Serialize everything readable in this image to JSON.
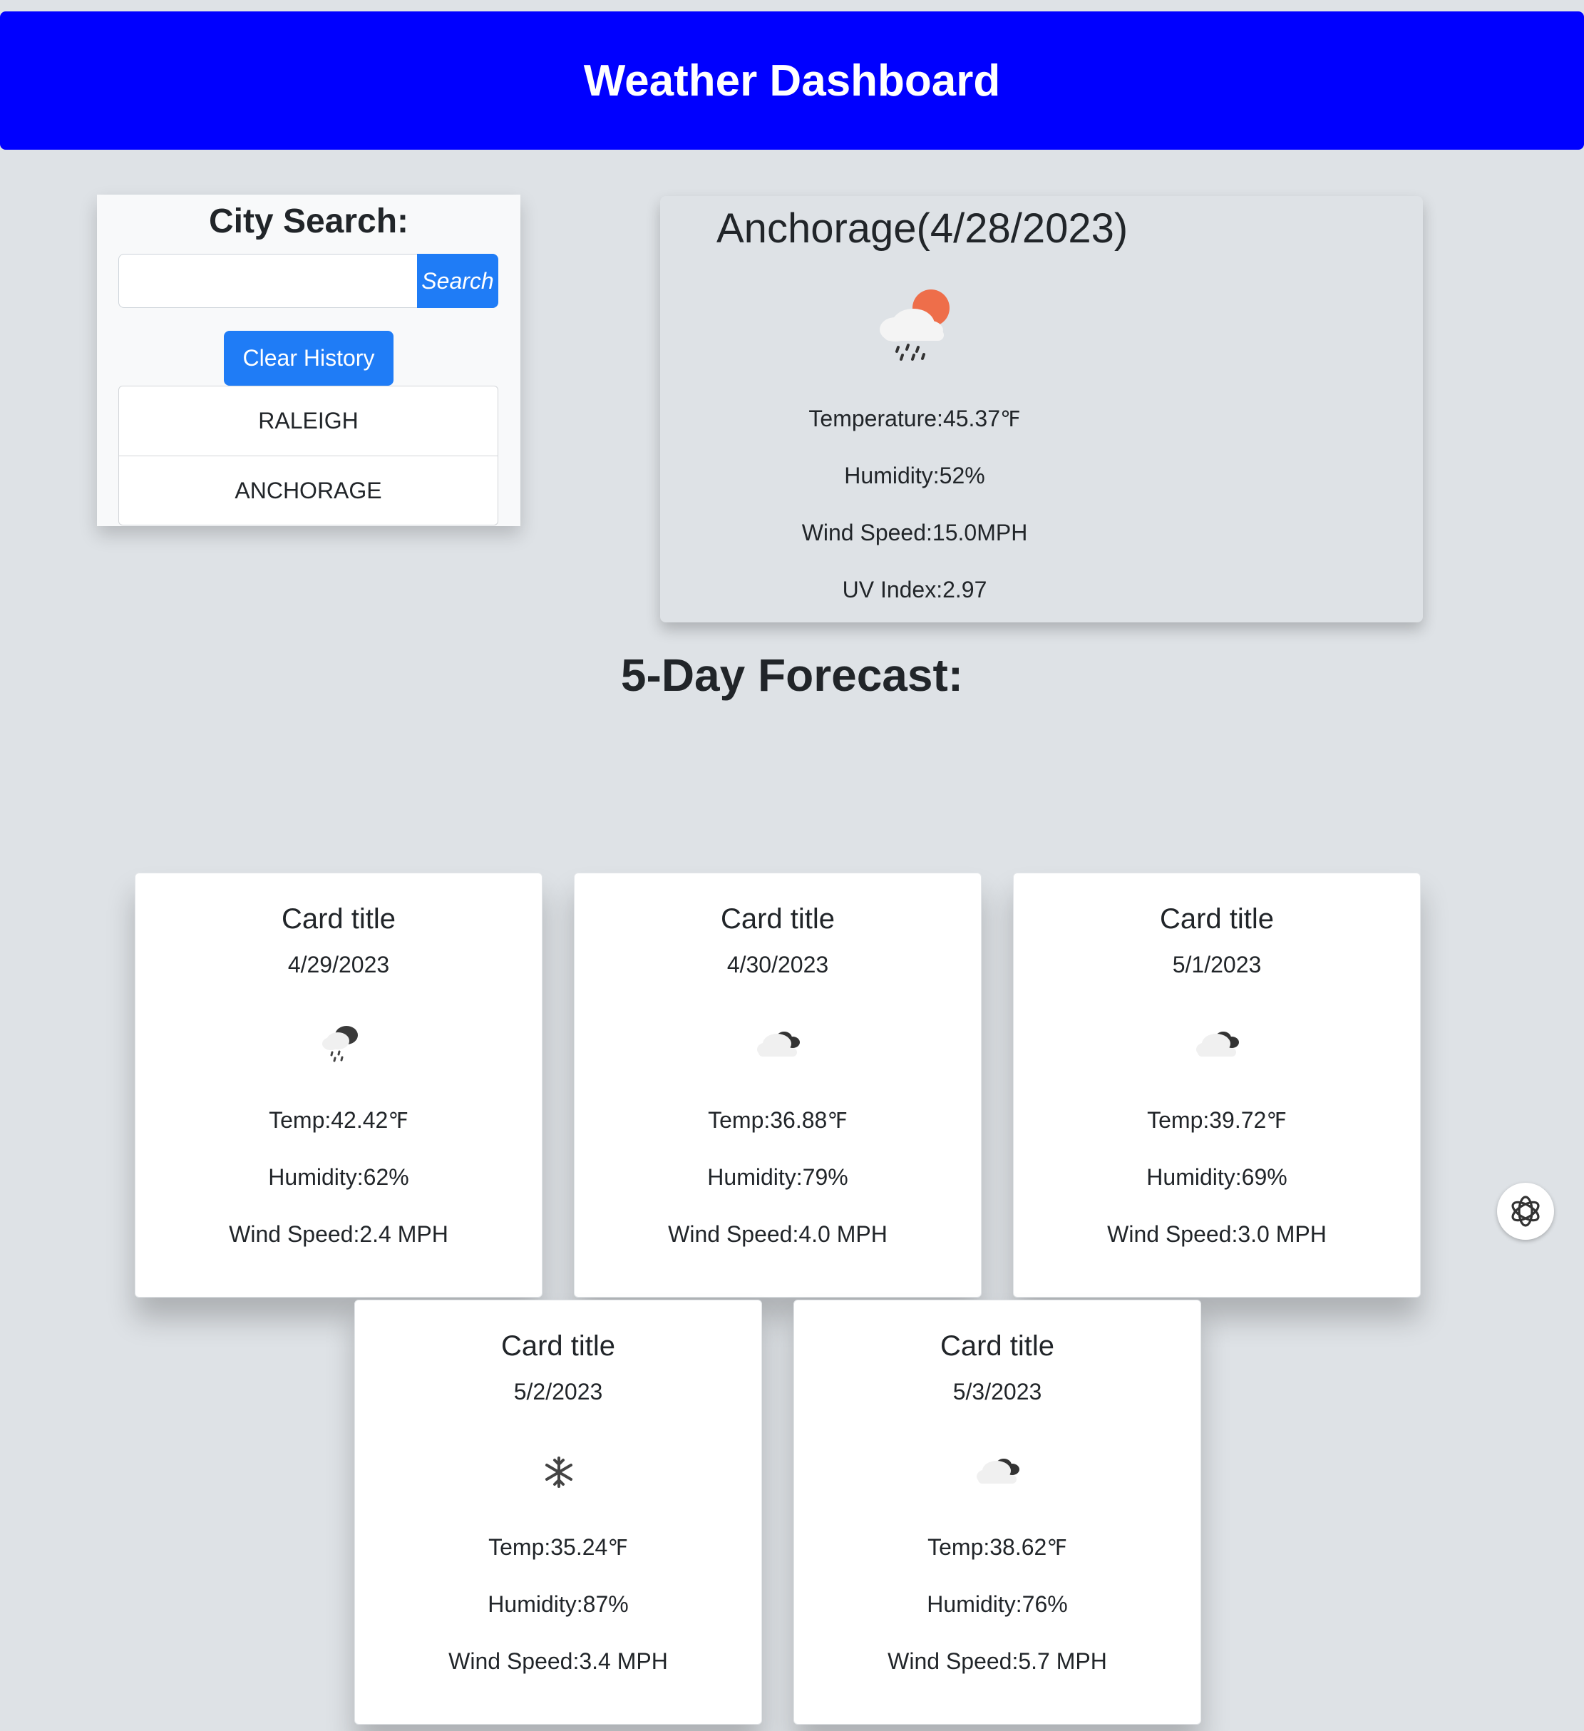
{
  "header": {
    "title": "Weather Dashboard",
    "color": "#0000ff"
  },
  "search": {
    "title": "City Search:",
    "input_value": "",
    "placeholder": "",
    "button_label": "Search",
    "clear_label": "Clear History",
    "history": [
      "RALEIGH",
      "ANCHORAGE"
    ]
  },
  "current": {
    "city_date": "Anchorage(4/28/2023)",
    "icon": "rain-sun-icon",
    "temperature_label": "Temperature:",
    "temperature_value": "45.37",
    "temperature_unit": "℉",
    "humidity": "Humidity:52%",
    "wind": "Wind Speed:15.0MPH",
    "uv": "UV Index:2.97"
  },
  "forecast": {
    "title": "5-Day Forecast:",
    "cards": [
      {
        "title": "Card title",
        "date": "4/29/2023",
        "icon": "rain-cloud-icon",
        "temp_label": "Temp:",
        "temp_value": "42.42",
        "temp_unit": "℉",
        "humidity": "Humidity:62%",
        "wind": "Wind Speed:2.4 MPH"
      },
      {
        "title": "Card title",
        "date": "4/30/2023",
        "icon": "broken-clouds-icon",
        "temp_label": "Temp:",
        "temp_value": "36.88",
        "temp_unit": "℉",
        "humidity": "Humidity:79%",
        "wind": "Wind Speed:4.0 MPH"
      },
      {
        "title": "Card title",
        "date": "5/1/2023",
        "icon": "broken-clouds-icon",
        "temp_label": "Temp:",
        "temp_value": "39.72",
        "temp_unit": "℉",
        "humidity": "Humidity:69%",
        "wind": "Wind Speed:3.0 MPH"
      },
      {
        "title": "Card title",
        "date": "5/2/2023",
        "icon": "snow-icon",
        "temp_label": "Temp:",
        "temp_value": "35.24",
        "temp_unit": "℉",
        "humidity": "Humidity:87%",
        "wind": "Wind Speed:3.4 MPH"
      },
      {
        "title": "Card title",
        "date": "5/3/2023",
        "icon": "broken-clouds-icon",
        "temp_label": "Temp:",
        "temp_value": "38.62",
        "temp_unit": "℉",
        "humidity": "Humidity:76%",
        "wind": "Wind Speed:5.7 MPH"
      }
    ]
  },
  "colors": {
    "page_bg": "#dee2e6",
    "primary_button": "#1f7cf6",
    "sun": "#ee6e4a"
  }
}
